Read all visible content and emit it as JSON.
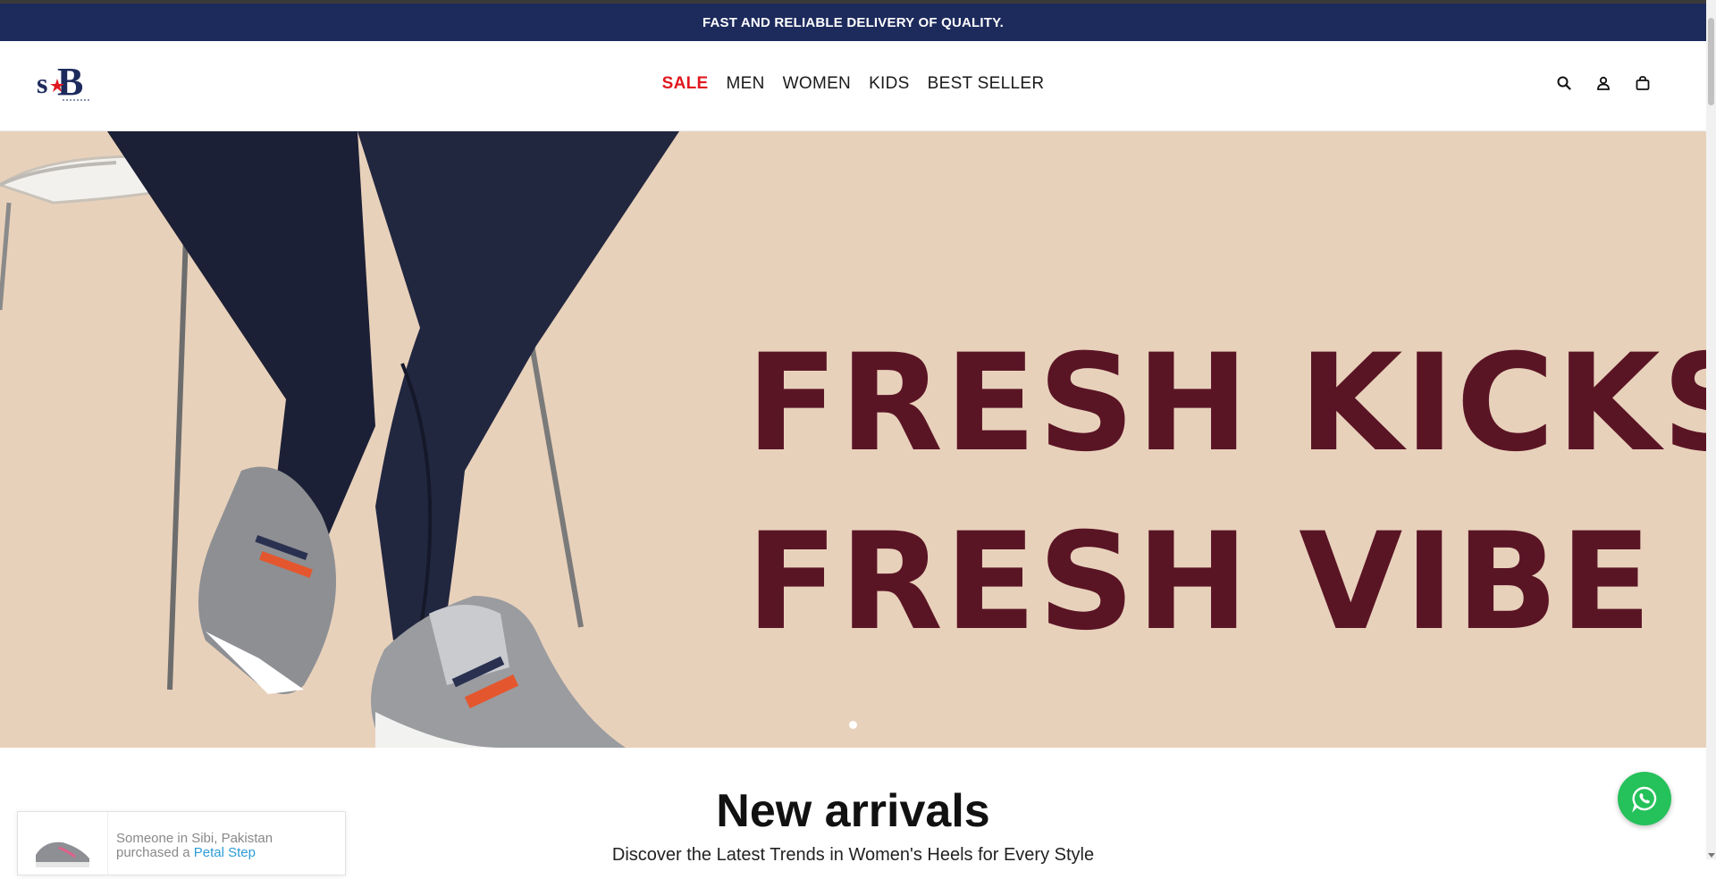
{
  "announcement": "FAST AND RELIABLE DELIVERY OF QUALITY.",
  "logo_text": "sB",
  "nav": {
    "items": [
      {
        "label": "SALE",
        "highlight": true
      },
      {
        "label": "MEN"
      },
      {
        "label": "WOMEN"
      },
      {
        "label": "KIDS"
      },
      {
        "label": "BEST SELLER"
      }
    ]
  },
  "header_icons": [
    "search-icon",
    "account-icon",
    "cart-icon"
  ],
  "hero": {
    "line1": "FRESH KICKS",
    "line2": "FRESH VIBE",
    "slide_count": 1,
    "active_slide": 1
  },
  "section": {
    "title": "New arrivals",
    "subtitle": "Discover the Latest Trends in Women's Heels for Every Style"
  },
  "popup": {
    "message": "Someone in Sibi, Pakistan",
    "purchased_prefix": "purchased a",
    "product": "Petal Step"
  },
  "colors": {
    "announcement_bg": "#1d2a5c",
    "sale": "#e0181e",
    "hero_bg": "#e8d1bb",
    "hero_text": "#5a1525",
    "whatsapp": "#25c15a"
  }
}
